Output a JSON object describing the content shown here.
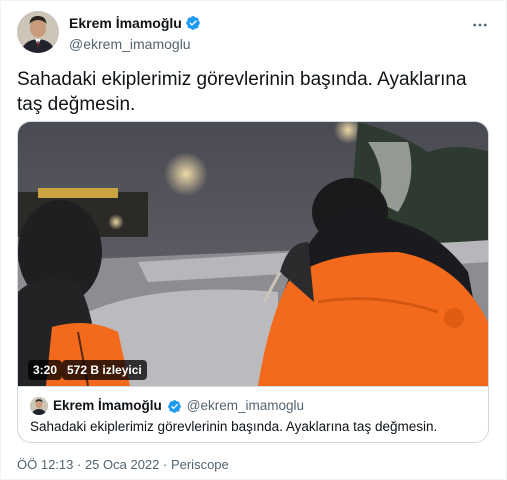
{
  "tweet": {
    "author": {
      "display_name": "Ekrem İmamoğlu",
      "handle": "@ekrem_imamoglu",
      "avatar_icon": "profile-photo",
      "verified_icon": "verified-badge-icon"
    },
    "more_icon": "more-dots-icon",
    "text": "Sahadaki ekiplerimiz görevlerinin başında. Ayaklarına taş değmesin.",
    "media": {
      "duration": "3:20",
      "views": "572 B izleyici"
    },
    "quote": {
      "display_name": "Ekrem İmamoğlu",
      "handle": "@ekrem_imamoglu",
      "text": "Sahadaki ekiplerimiz görevlerinin başında. Ayaklarına taş değmesin."
    },
    "meta": {
      "time": "ÖÖ 12:13",
      "separator1": " · ",
      "date": "25 Oca 2022",
      "separator2": " · ",
      "source": "Periscope"
    }
  },
  "colors": {
    "text": "#0f1419",
    "secondary": "#536471",
    "verified": "#1d9bf0",
    "border": "#cfd9de",
    "vest": "#f36a1c"
  }
}
